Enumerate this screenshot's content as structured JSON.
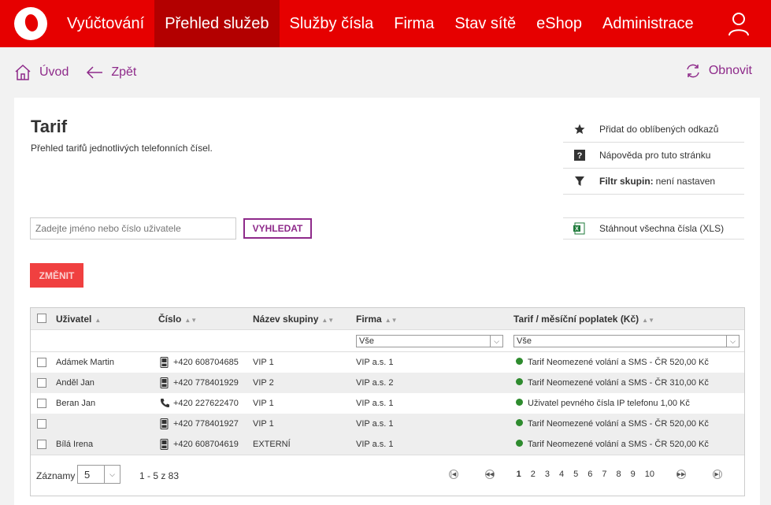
{
  "nav": {
    "items": [
      "Vyúčtování",
      "Přehled služeb",
      "Služby čísla",
      "Firma",
      "Stav sítě",
      "eShop",
      "Administrace"
    ],
    "active_index": 1
  },
  "subnav": {
    "home": "Úvod",
    "back": "Zpět",
    "refresh": "Obnovit"
  },
  "page": {
    "title": "Tarif",
    "subtitle": "Přehled tarifů jednotlivých telefonních čísel."
  },
  "side": {
    "favorite": "Přidat do oblíbených odkazů",
    "help": "Nápověda pro tuto stránku",
    "filter_label": "Filtr skupin:",
    "filter_value": "není nastaven",
    "download": "Stáhnout všechna čísla (XLS)"
  },
  "search": {
    "placeholder": "Zadejte jméno nebo číslo uživatele",
    "button": "VYHLEDAT"
  },
  "change_button": "ZMĚNIT",
  "table": {
    "headers": [
      "Uživatel",
      "Číslo",
      "Název skupiny",
      "Firma",
      "Tarif / měsíční poplatek (Kč)"
    ],
    "filter_firma": "Vše",
    "filter_tarif": "Vše",
    "rows": [
      {
        "user": "Adámek Martin",
        "number": "+420 608704685",
        "group": "VIP 1",
        "company": "VIP a.s. 1",
        "tariff": "Tarif Neomezené volání a SMS - ČR 520,00 Kč",
        "phone_icon": "mobile-icon"
      },
      {
        "user": "Anděl Jan",
        "number": "+420 778401929",
        "group": "VIP 2",
        "company": "VIP a.s. 2",
        "tariff": "Tarif Neomezené volání a SMS - ČR 310,00 Kč",
        "phone_icon": "mobile-icon"
      },
      {
        "user": "Beran Jan",
        "number": "+420 227622470",
        "group": "VIP 1",
        "company": "VIP a.s. 1",
        "tariff": "Uživatel pevného čísla IP telefonu 1,00 Kč",
        "phone_icon": "landline-icon"
      },
      {
        "user": "",
        "number": "+420 778401927",
        "group": "VIP 1",
        "company": "VIP a.s. 1",
        "tariff": "Tarif Neomezené volání a SMS - ČR 520,00 Kč",
        "phone_icon": "mobile-icon"
      },
      {
        "user": "Bílá Irena",
        "number": "+420 608704619",
        "group": "EXTERNÍ",
        "company": "VIP a.s. 1",
        "tariff": "Tarif Neomezené volání a SMS - ČR 520,00 Kč",
        "phone_icon": "mobile-icon"
      }
    ]
  },
  "footer": {
    "records_label": "Záznamy",
    "records_value": "5",
    "range": "1 - 5 z 83",
    "pages": [
      "1",
      "2",
      "3",
      "4",
      "5",
      "6",
      "7",
      "8",
      "9",
      "10"
    ],
    "current_page": "1"
  },
  "colors": {
    "brand": "#e60000",
    "accent": "#8e2a8a",
    "status_ok": "#2e8b2e"
  }
}
